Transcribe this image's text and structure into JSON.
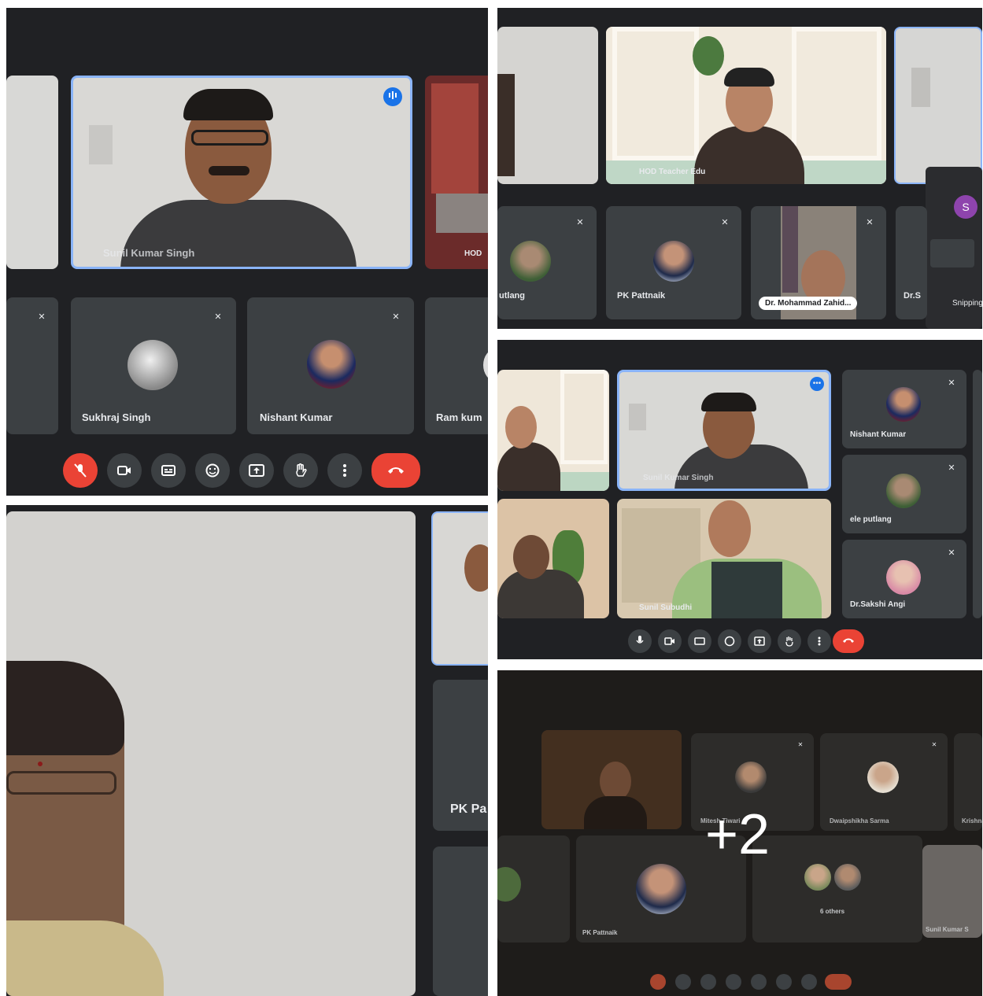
{
  "panels": {
    "top_left": {
      "main_speaker": "Sunil Kumar Singh",
      "side_tile_label": "HOD",
      "participants": [
        {
          "name": "Sukhraj Singh"
        },
        {
          "name": "Nishant Kumar"
        },
        {
          "name": "Ram kum"
        }
      ]
    },
    "top_right": {
      "main_speaker": "HOD Teacher Edu",
      "participants": [
        {
          "name": "utlang"
        },
        {
          "name": "PK Pattnaik"
        },
        {
          "name": "Dr. Mohammad Zahid..."
        },
        {
          "name": "Dr.S"
        }
      ],
      "popup_avatar_letter": "S",
      "popup_item": "Snipping"
    },
    "middle_right": {
      "main_speaker": "Sunil Kumar Singh",
      "bottom_speaker": "Sunil Subudhi",
      "participants": [
        {
          "name": "Nishant Kumar"
        },
        {
          "name": "ele putlang"
        },
        {
          "name": "Dr.Sakshi Angi"
        }
      ]
    },
    "bottom_left": {
      "side_label": "PK Pa"
    },
    "bottom_right": {
      "overlay_count": "+2",
      "participants": [
        {
          "name": "Mitesh Tiwari"
        },
        {
          "name": "Dwaipshikha Sarma"
        },
        {
          "name": "Krishna"
        },
        {
          "name": "PK Pattnaik"
        },
        {
          "name": "6 others"
        },
        {
          "name": "Sunil Kumar S"
        }
      ]
    }
  },
  "colors": {
    "meet_bg": "#202124",
    "tile_bg": "#3c4043",
    "end_call": "#ea4335",
    "active_border": "#8ab4f8"
  },
  "icons": [
    "mic-off-icon",
    "camera-icon",
    "captions-icon",
    "emoji-icon",
    "present-icon",
    "hand-icon",
    "more-icon",
    "end-call-icon",
    "audio-level-icon"
  ]
}
